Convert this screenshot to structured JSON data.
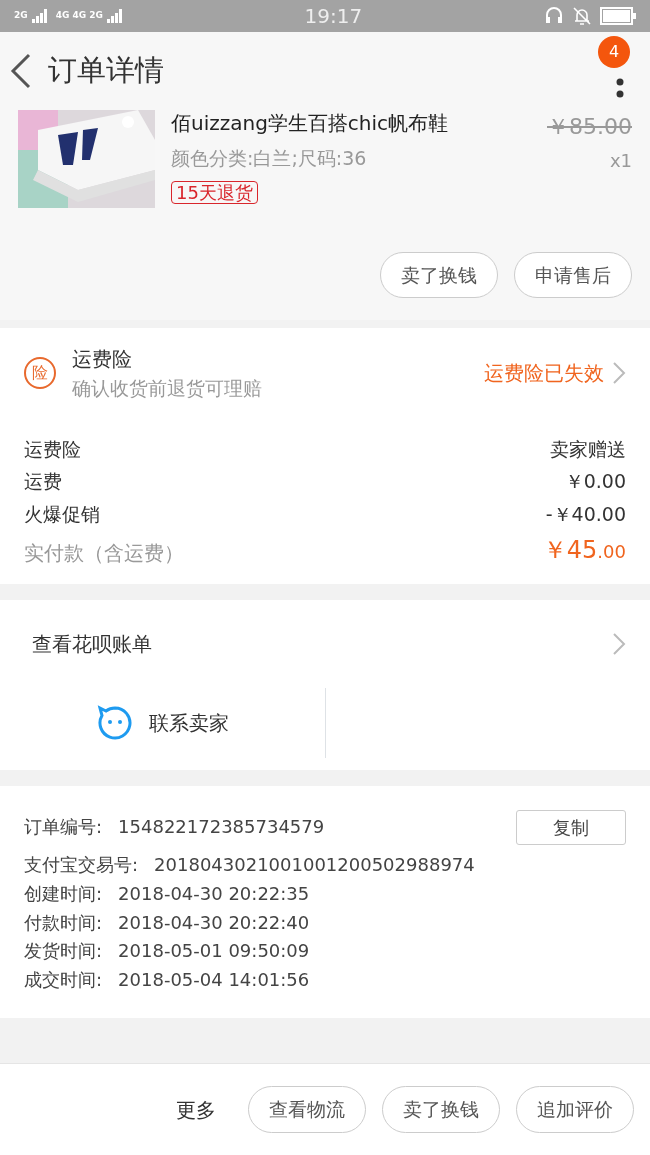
{
  "status_bar": {
    "time": "19:17",
    "signal_1": "2G",
    "signal_2": "4G 4G 2G"
  },
  "header": {
    "title": "订单详情",
    "badge": "4"
  },
  "product": {
    "title": "佰uizzang学生百搭chic帆布鞋",
    "spec": "颜色分类:白兰;尺码:36",
    "tag": "15天退货",
    "price": "￥85.00",
    "quantity": "x1",
    "buttons": [
      "卖了换钱",
      "申请售后"
    ]
  },
  "insurance": {
    "icon_text": "险",
    "title": "运费险",
    "subtitle": "确认收货前退货可理赔",
    "status": "运费险已失效"
  },
  "fees": [
    {
      "label": "运费险",
      "value": "卖家赠送",
      "kind": "plain"
    },
    {
      "label": "运费",
      "value": "￥0.00",
      "kind": "plain"
    },
    {
      "label": "火爆促销",
      "value": "-￥40.00",
      "kind": "plain"
    },
    {
      "label": "实付款（含运费）",
      "value": "￥45",
      "cents": ".00",
      "kind": "total"
    }
  ],
  "huabei": {
    "label": "查看花呗账单"
  },
  "contact": {
    "label": "联系卖家"
  },
  "order_info": {
    "copy_button": "复制",
    "rows": [
      {
        "label": "订单编号:",
        "value": "154822172385734579"
      },
      {
        "label": "支付宝交易号:",
        "value": "2018043021001001200502988974"
      },
      {
        "label": "创建时间:",
        "value": "2018-04-30 20:22:35"
      },
      {
        "label": "付款时间:",
        "value": "2018-04-30 20:22:40"
      },
      {
        "label": "发货时间:",
        "value": "2018-05-01 09:50:09"
      },
      {
        "label": "成交时间:",
        "value": "2018-05-04 14:01:56"
      }
    ]
  },
  "bottom_bar": {
    "more": "更多",
    "buttons": [
      "查看物流",
      "卖了换钱",
      "追加评价"
    ]
  }
}
